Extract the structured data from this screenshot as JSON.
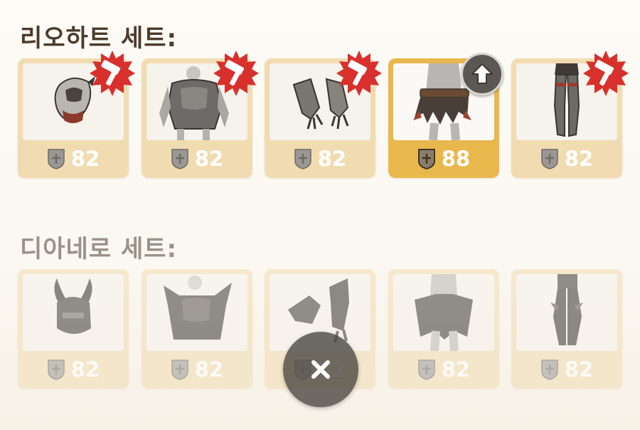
{
  "sets": [
    {
      "title": "리오하트 세트:",
      "items": [
        {
          "slot": "helmet",
          "level": "82",
          "badge": "hammer-icon"
        },
        {
          "slot": "chest",
          "level": "82",
          "badge": "hammer-icon"
        },
        {
          "slot": "gauntlets",
          "level": "82",
          "badge": "hammer-icon"
        },
        {
          "slot": "waist",
          "level": "88",
          "badge": "upgrade-arrow-icon"
        },
        {
          "slot": "legs",
          "level": "82",
          "badge": "hammer-icon"
        }
      ]
    },
    {
      "title": "디아네로 세트:",
      "items": [
        {
          "slot": "helmet",
          "level": "82"
        },
        {
          "slot": "chest",
          "level": "82"
        },
        {
          "slot": "gauntlets",
          "level": "82"
        },
        {
          "slot": "waist",
          "level": "82"
        },
        {
          "slot": "legs",
          "level": "82"
        }
      ]
    }
  ],
  "close_button": {
    "icon": "close-icon"
  },
  "colors": {
    "card": "#f1dcb1",
    "card_highlight": "#e9b84d",
    "badge_red": "#d8302c",
    "title": "#4a3b2b"
  }
}
